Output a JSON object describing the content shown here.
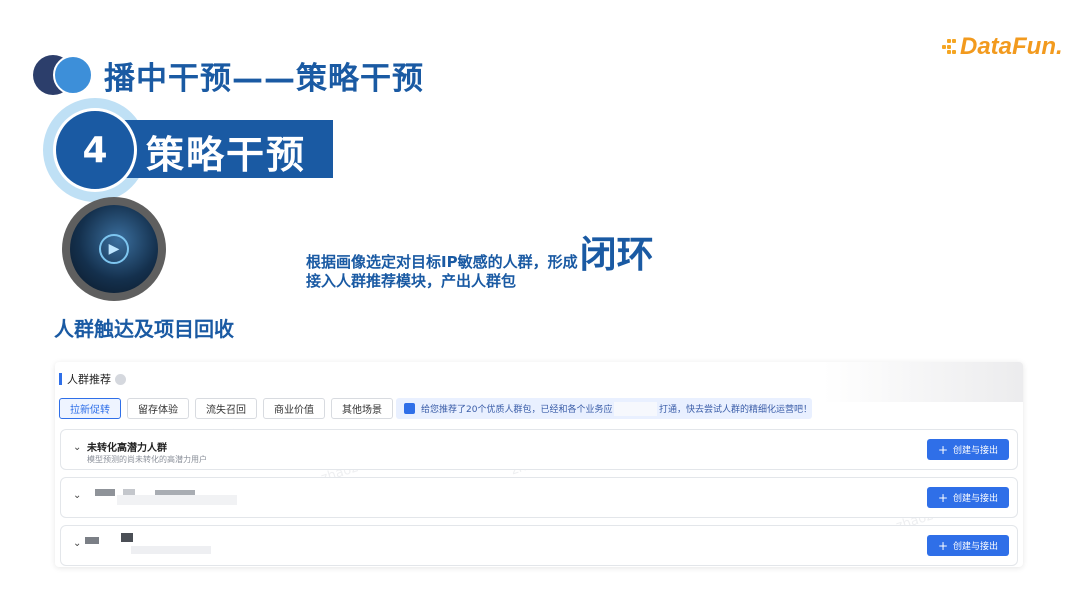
{
  "slide": {
    "title": "播中干预——策略干预",
    "step_number": "4",
    "step_title": "策略干预",
    "section_label": "人群触达及项目回收",
    "description_line1_prefix": "根据画像选定对目标IP敏感的人群，形成",
    "description_line1_emphasis": "闭环",
    "description_line2": "接入人群推荐模块，产出人群包"
  },
  "logo": {
    "text": "DataFun."
  },
  "panel": {
    "title": "人群推荐",
    "tabs": [
      {
        "label": "拉新促转",
        "active": true
      },
      {
        "label": "留存体验",
        "active": false
      },
      {
        "label": "流失召回",
        "active": false
      },
      {
        "label": "商业价值",
        "active": false
      },
      {
        "label": "其他场景",
        "active": false
      }
    ],
    "notice_prefix": "给您推荐了20个优质人群包，已经和各个业务应",
    "notice_suffix": "打通，快去尝试人群的精细化运营吧！",
    "rows": [
      {
        "title": "未转化高潜力人群",
        "subtitle": "模型预测的尚未转化的高潜力用户",
        "button_label": "创建与接出"
      },
      {
        "title": "",
        "subtitle": "",
        "button_label": "创建与接出"
      },
      {
        "title": "",
        "subtitle": "",
        "button_label": "创建与接出"
      }
    ],
    "watermark": "zhaozeng"
  },
  "colors": {
    "brand_blue": "#1a5aa3",
    "accent_blue": "#2f6fe8",
    "logo_orange": "#f29a1e"
  },
  "icons": {
    "title_icon": "double-circle-icon",
    "avatar_icon": "play-icon",
    "info_icon": "info-icon",
    "notice_icon": "shield-icon",
    "row_toggle": "chevron-down-icon",
    "button_icon": "plus-icon"
  }
}
